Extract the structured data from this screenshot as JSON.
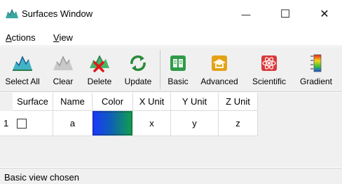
{
  "window": {
    "title": "Surfaces Window",
    "minimize_glyph": "—",
    "maximize_glyph": "☐",
    "close_glyph": "✕"
  },
  "menu": {
    "items": [
      {
        "label": "Actions",
        "mnemonic": "A",
        "rest": "ctions"
      },
      {
        "label": "View",
        "mnemonic": "V",
        "rest": "iew"
      }
    ]
  },
  "toolbar": {
    "buttons": [
      {
        "label": "Select All",
        "icon": "surface-icon"
      },
      {
        "label": "Clear",
        "icon": "surface-gray-icon"
      },
      {
        "label": "Delete",
        "icon": "surface-delete-icon"
      },
      {
        "label": "Update",
        "icon": "refresh-icon"
      },
      {
        "label": "Basic",
        "icon": "basic-book-icon"
      },
      {
        "label": "Advanced",
        "icon": "advanced-hat-icon"
      },
      {
        "label": "Scientific",
        "icon": "atom-icon"
      },
      {
        "label": "Gradient",
        "icon": "gradient-bar-icon"
      }
    ]
  },
  "table": {
    "columns": [
      "Surface",
      "Name",
      "Color",
      "X Unit",
      "Y Unit",
      "Z Unit"
    ],
    "rows": [
      {
        "index": "1",
        "surface_checked": false,
        "name": "a",
        "color": "gradient blue-green",
        "x_unit": "x",
        "y_unit": "y",
        "z_unit": "z"
      }
    ]
  },
  "status": {
    "text": "Basic view chosen"
  }
}
